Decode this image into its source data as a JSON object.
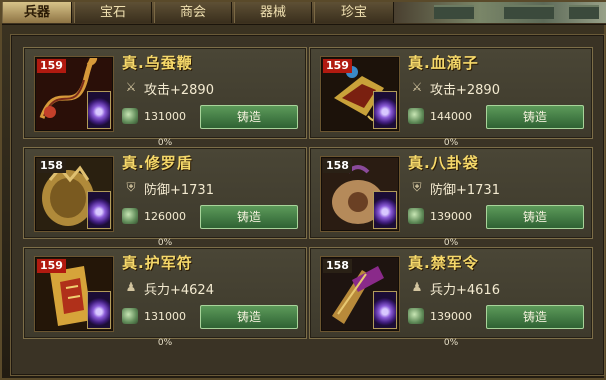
{
  "tabs": [
    {
      "label": "兵器",
      "active": true
    },
    {
      "label": "宝石",
      "active": false
    },
    {
      "label": "商会",
      "active": false
    },
    {
      "label": "器械",
      "active": false
    },
    {
      "label": "珍宝",
      "active": false
    }
  ],
  "items": [
    {
      "name": "真.乌蚕鞭",
      "level": "159",
      "level_style": "red",
      "stat_icon": "sword-icon",
      "stat": "攻击+2890",
      "cost": "131000",
      "button": "铸造",
      "progress": "0%",
      "art": "whip-art"
    },
    {
      "name": "真.血滴子",
      "level": "159",
      "level_style": "red",
      "stat_icon": "sword-icon",
      "stat": "攻击+2890",
      "cost": "144000",
      "button": "铸造",
      "progress": "0%",
      "art": "blood-drop-art"
    },
    {
      "name": "真.修罗盾",
      "level": "158",
      "level_style": "plain",
      "stat_icon": "shield-icon",
      "stat": "防御+1731",
      "cost": "126000",
      "button": "铸造",
      "progress": "0%",
      "art": "shield-art"
    },
    {
      "name": "真.八卦袋",
      "level": "158",
      "level_style": "plain",
      "stat_icon": "shield-icon",
      "stat": "防御+1731",
      "cost": "139000",
      "button": "铸造",
      "progress": "0%",
      "art": "bagua-bag-art"
    },
    {
      "name": "真.护军符",
      "level": "159",
      "level_style": "red",
      "stat_icon": "soldier-icon",
      "stat": "兵力+4624",
      "cost": "131000",
      "button": "铸造",
      "progress": "0%",
      "art": "talisman-art"
    },
    {
      "name": "真.禁军令",
      "level": "158",
      "level_style": "plain",
      "stat_icon": "soldier-icon",
      "stat": "兵力+4616",
      "cost": "139000",
      "button": "铸造",
      "progress": "0%",
      "art": "command-token-art"
    }
  ],
  "colors": {
    "item_name": "#f6d96a",
    "forge_button": "#3f7a3f",
    "level_badge_red": "#b11a10"
  }
}
